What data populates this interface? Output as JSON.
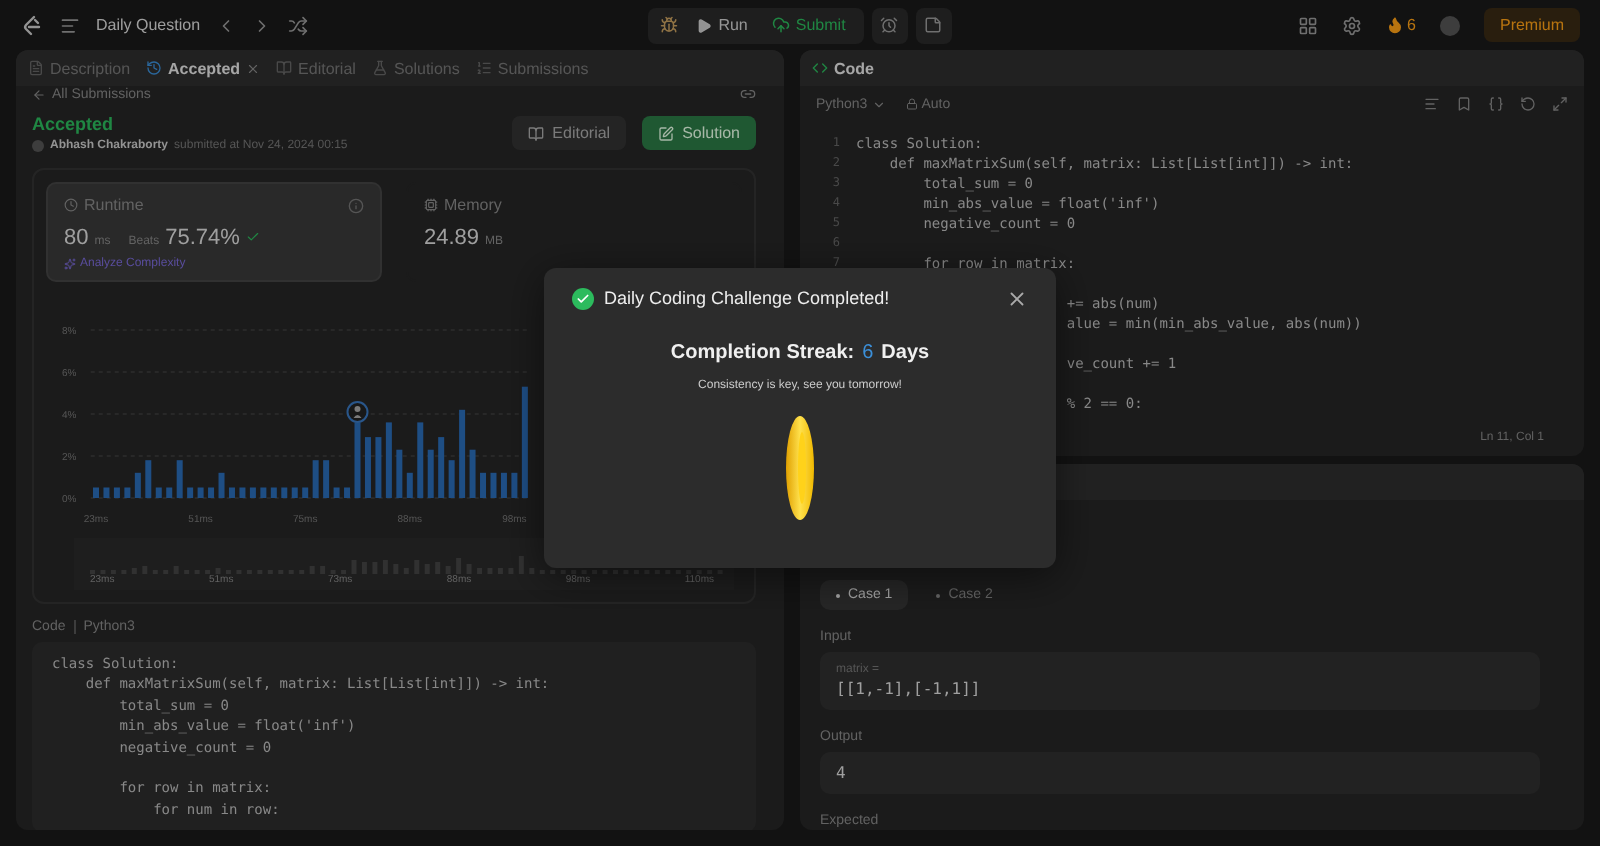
{
  "top_bar": {
    "title": "Daily Question",
    "run": "Run",
    "submit": "Submit",
    "streak_count": "6",
    "premium": "Premium"
  },
  "left_panel": {
    "tabs": [
      {
        "label": "Description",
        "selected": false,
        "closable": false,
        "kind": "description"
      },
      {
        "label": "Accepted",
        "selected": true,
        "closable": true,
        "kind": "result"
      },
      {
        "label": "Editorial",
        "selected": false,
        "closable": false,
        "kind": "editorial"
      },
      {
        "label": "Solutions",
        "selected": false,
        "closable": false,
        "kind": "solutions"
      },
      {
        "label": "Submissions",
        "selected": false,
        "closable": false,
        "kind": "submissions"
      }
    ],
    "back_link": "All Submissions",
    "status": "Accepted",
    "author": "Abhash Chakraborty",
    "submitted": "submitted at Nov 24, 2024 00:15",
    "buttons": [
      {
        "label": "Editorial",
        "kind": "secondary"
      },
      {
        "label": "Solution",
        "kind": "primary"
      }
    ],
    "stats": [
      {
        "title": "Runtime",
        "value": "80",
        "unit": "ms",
        "beats_label": "Beats",
        "beats": "75.74%",
        "link": "Analyze Complexity",
        "selected": true,
        "kind": "runtime"
      },
      {
        "title": "Memory",
        "value": "24.89",
        "unit": "MB",
        "selected": false,
        "kind": "memory"
      }
    ],
    "chart_data": {
      "type": "bar",
      "ylim": [
        0,
        8
      ],
      "grid": true,
      "yticks": [
        {
          "value": 0,
          "label": "0%"
        },
        {
          "value": 2,
          "label": "2%"
        },
        {
          "value": 4,
          "label": "4%"
        },
        {
          "value": 6,
          "label": "6%"
        },
        {
          "value": 8,
          "label": "8%"
        }
      ],
      "categories": [
        "23ms",
        null,
        null,
        null,
        null,
        null,
        null,
        null,
        null,
        null,
        "51ms",
        null,
        null,
        null,
        null,
        null,
        null,
        null,
        null,
        null,
        "75ms",
        null,
        null,
        null,
        null,
        null,
        null,
        null,
        null,
        null,
        "88ms",
        null,
        null,
        null,
        null,
        null,
        null,
        null,
        null,
        null,
        "98ms",
        null
      ],
      "values": [
        0.5,
        0.5,
        0.5,
        0.5,
        1.2,
        1.8,
        0.5,
        0.5,
        1.8,
        0.5,
        0.5,
        0.5,
        1.2,
        0.5,
        0.5,
        0.5,
        0.5,
        0.5,
        0.5,
        0.5,
        0.5,
        1.8,
        1.8,
        0.5,
        0.5,
        3.6,
        2.9,
        2.9,
        3.6,
        2.3,
        1.2,
        3.6,
        2.3,
        2.9,
        1.8,
        4.2,
        2.3,
        1.2,
        1.2,
        1.2,
        1.2,
        5.3
      ]
    },
    "brush_labels": [
      "23ms",
      "51ms",
      "73ms",
      "88ms",
      "98ms",
      "110ms"
    ],
    "code_label": "Code",
    "code_language": "Python3",
    "code": [
      {
        "kind": "code",
        "text": "class Solution:"
      },
      {
        "kind": "code",
        "text": "    def maxMatrixSum(self, matrix: List[List[int]]) -> int:"
      },
      {
        "kind": "code",
        "text": "        total_sum = 0"
      },
      {
        "kind": "code",
        "text": "        min_abs_value = float('inf')"
      },
      {
        "kind": "code",
        "text": "        negative_count = 0"
      },
      {
        "kind": "blank"
      },
      {
        "kind": "code",
        "text": "        for row in matrix:"
      },
      {
        "kind": "code",
        "text": "            for num in row:"
      }
    ]
  },
  "right_panel": {
    "title": "Code",
    "language": "Python3",
    "mode": "Auto",
    "lines": [
      {
        "kind": "code",
        "number": "1",
        "text": "class Solution:"
      },
      {
        "kind": "code",
        "number": "2",
        "text": "    def maxMatrixSum(self, matrix: List[List[int]]) -> int:"
      },
      {
        "kind": "code",
        "number": "3",
        "text": "        total_sum = 0"
      },
      {
        "kind": "code",
        "number": "4",
        "text": "        min_abs_value = float('inf')"
      },
      {
        "kind": "code",
        "number": "5",
        "text": "        negative_count = 0"
      },
      {
        "kind": "code",
        "number": "6"
      },
      {
        "kind": "code",
        "number": "7",
        "text": "        for row in matrix:"
      },
      {
        "kind": "blank"
      },
      {
        "kind": "code",
        "text": "                         += abs(num)"
      },
      {
        "kind": "code",
        "text": "                         alue = min(min_abs_value, abs(num))"
      },
      {
        "kind": "blank"
      },
      {
        "kind": "code",
        "text": "                         ve_count += 1"
      },
      {
        "kind": "blank"
      },
      {
        "kind": "code",
        "text": "                         % 2 == 0:"
      }
    ],
    "cursor": "Ln 11, Col 1",
    "cases": [
      {
        "label": "Case 1",
        "selected": true
      },
      {
        "label": "Case 2",
        "selected": false
      }
    ],
    "input_label": "Input",
    "inputs": [
      {
        "name": "matrix =",
        "value": "[[1,-1],[-1,1]]"
      }
    ],
    "output_label": "Output",
    "output": "4",
    "expected_label": "Expected"
  },
  "modal": {
    "title": "Daily Coding Challenge Completed!",
    "streak_label": "Completion Streak:",
    "streak_value": "6",
    "streak_unit": "Days",
    "message": "Consistency is key, see you tomorrow!"
  }
}
